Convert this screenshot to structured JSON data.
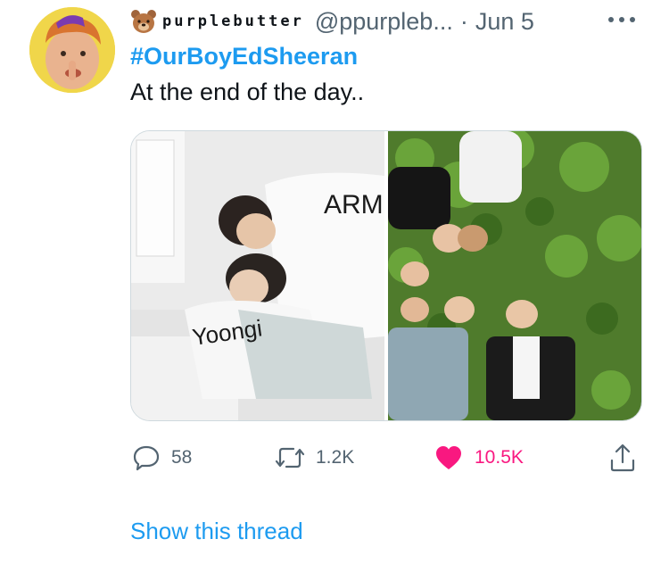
{
  "tweet": {
    "display_name": "purplebutter",
    "handle": "@ppurpleb...",
    "separator": "·",
    "date": "Jun 5",
    "hashtag": "#OurBoyEdSheeran",
    "text": "At the end of the day..",
    "media": {
      "left_caption_top": "ARM",
      "left_caption_bottom": "Yoongi"
    },
    "actions": {
      "replies": "58",
      "retweets": "1.2K",
      "likes": "10.5K"
    },
    "show_thread": "Show this thread"
  },
  "colors": {
    "link": "#1d9bf0",
    "like": "#f91880",
    "secondary": "#536471"
  },
  "icons": [
    "bear-emoji-icon",
    "more-icon",
    "reply-icon",
    "retweet-icon",
    "heart-icon",
    "share-icon"
  ]
}
